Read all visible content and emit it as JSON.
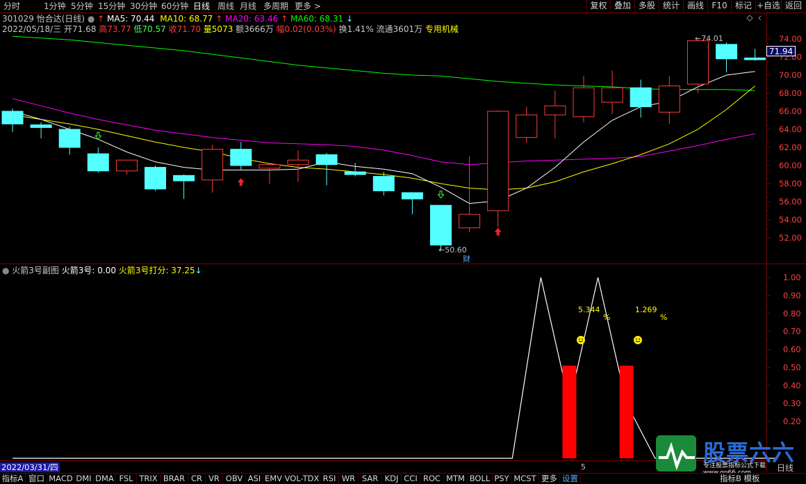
{
  "topbar": {
    "periods": [
      "分时",
      "1分钟",
      "5分钟",
      "15分钟",
      "30分钟",
      "60分钟",
      "日线",
      "周线",
      "月线",
      "多周期",
      "更多 >"
    ],
    "active_period": "日线",
    "right_buttons": [
      "复权",
      "叠加",
      "多股",
      "统计",
      "画线",
      "F10",
      "标记",
      "+自选",
      "返回"
    ]
  },
  "stock_info": {
    "code_name": "301029 怡合达(日线)",
    "ma5": "MA5: 70.44",
    "ma10": "MA10: 68.77",
    "ma20": "MA20: 63.46",
    "ma60": "MA60: 68.31",
    "date": "2022/05/18/三",
    "open": "开71.68",
    "high": "高73.77",
    "low": "低70.57",
    "close": "收71.70",
    "volume": "量5073",
    "amount": "额3666万",
    "change": "幅0.02(0.03%)",
    "turnover": "换1.41%",
    "float": "流通3601万",
    "industry": "专用机械"
  },
  "price_axis": {
    "labels": [
      "74.00",
      "72.00",
      "70.00",
      "68.00",
      "66.00",
      "64.00",
      "62.00",
      "60.00",
      "58.00",
      "56.00",
      "54.00",
      "52.00"
    ],
    "current_price": "71.94",
    "max_label": "74.01",
    "min_label": "50.60",
    "finance_tag": "财"
  },
  "indicator": {
    "title": "火箭3号副图",
    "value1": "火箭3号: 0.00",
    "value2": "火箭3号打分: 37.25",
    "axis_labels": [
      "1.00",
      "0.90",
      "0.80",
      "0.70",
      "0.60",
      "0.50",
      "0.40",
      "0.30",
      "0.20"
    ],
    "pct1": "5.344",
    "pct2": "1.269",
    "pct_sign": "%",
    "date_box": "2022/03/31/四",
    "tick": "5",
    "period_corner": "日线"
  },
  "chart_data": {
    "type": "candlestick",
    "ylim": [
      50.5,
      75.5
    ],
    "candles": [
      {
        "o": 66.0,
        "h": 66.3,
        "c": 64.6,
        "l": 63.7
      },
      {
        "o": 64.5,
        "h": 64.8,
        "c": 64.2,
        "l": 63.0
      },
      {
        "o": 64.0,
        "h": 64.3,
        "c": 62.0,
        "l": 61.2
      },
      {
        "o": 61.3,
        "h": 62.0,
        "c": 59.4,
        "l": 59.2
      },
      {
        "o": 59.4,
        "h": 60.5,
        "c": 60.6,
        "l": 59.0
      },
      {
        "o": 59.8,
        "h": 60.0,
        "c": 57.4,
        "l": 57.2
      },
      {
        "o": 58.9,
        "h": 59.0,
        "c": 58.3,
        "l": 56.3
      },
      {
        "o": 58.4,
        "h": 62.3,
        "c": 61.8,
        "l": 57.0
      },
      {
        "o": 61.8,
        "h": 62.6,
        "c": 60.0,
        "l": 59.5
      },
      {
        "o": 59.7,
        "h": 60.3,
        "c": 60.1,
        "l": 58.0
      },
      {
        "o": 60.1,
        "h": 61.7,
        "c": 60.6,
        "l": 58.2
      },
      {
        "o": 61.2,
        "h": 61.4,
        "c": 60.1,
        "l": 57.8
      },
      {
        "o": 59.3,
        "h": 60.3,
        "c": 59.0,
        "l": 58.8
      },
      {
        "o": 58.8,
        "h": 59.3,
        "c": 57.2,
        "l": 56.7
      },
      {
        "o": 57.0,
        "h": 57.0,
        "c": 56.3,
        "l": 54.6
      },
      {
        "o": 55.6,
        "h": 55.6,
        "c": 51.2,
        "l": 50.6
      },
      {
        "o": 53.1,
        "h": 61.0,
        "c": 54.6,
        "l": 52.6
      },
      {
        "o": 55.0,
        "h": 66.1,
        "c": 66.0,
        "l": 53.2
      },
      {
        "o": 63.1,
        "h": 66.5,
        "c": 65.6,
        "l": 62.5
      },
      {
        "o": 65.6,
        "h": 68.3,
        "c": 66.6,
        "l": 63.0
      },
      {
        "o": 65.4,
        "h": 69.9,
        "c": 68.6,
        "l": 64.8
      },
      {
        "o": 67.0,
        "h": 70.5,
        "c": 68.6,
        "l": 65.7
      },
      {
        "o": 68.6,
        "h": 69.5,
        "c": 66.5,
        "l": 65.3
      },
      {
        "o": 65.9,
        "h": 69.9,
        "c": 68.8,
        "l": 64.6
      },
      {
        "o": 69.0,
        "h": 74.0,
        "c": 73.8,
        "l": 68.0
      },
      {
        "o": 73.4,
        "h": 73.6,
        "c": 71.8,
        "l": 70.3
      },
      {
        "o": 71.9,
        "h": 72.9,
        "c": 71.7,
        "l": 71.6
      }
    ],
    "ma5": [
      66.0,
      65.1,
      64.0,
      62.9,
      61.5,
      60.4,
      59.8,
      59.5,
      59.5,
      59.5,
      59.6,
      60.4,
      59.9,
      59.6,
      59.1,
      57.6,
      55.8,
      56.1,
      57.5,
      59.8,
      62.6,
      65.0,
      66.5,
      67.1,
      68.7,
      70.0,
      70.4
    ],
    "ma10": [
      65.6,
      65.1,
      64.6,
      64.0,
      63.3,
      62.6,
      62.0,
      61.5,
      60.8,
      60.2,
      59.8,
      59.6,
      59.3,
      59.0,
      58.6,
      58.0,
      57.5,
      57.3,
      57.5,
      58.2,
      59.3,
      60.2,
      61.2,
      62.4,
      64.0,
      66.2,
      68.8
    ],
    "ma20": [
      67.4,
      66.6,
      65.8,
      65.1,
      64.5,
      63.9,
      63.5,
      63.1,
      62.8,
      62.5,
      62.4,
      62.3,
      62.1,
      61.7,
      61.1,
      60.4,
      60.1,
      60.3,
      60.5,
      60.6,
      60.7,
      60.8,
      61.0,
      61.6,
      62.2,
      62.9,
      63.5
    ],
    "ma60": [
      74.3,
      74.1,
      73.9,
      73.6,
      73.3,
      73.0,
      72.7,
      72.3,
      71.9,
      71.5,
      71.1,
      70.8,
      70.5,
      70.2,
      70.0,
      69.9,
      69.6,
      69.3,
      69.1,
      68.9,
      68.8,
      68.7,
      68.5,
      68.4,
      68.4,
      68.4,
      68.3
    ],
    "indicator_line": [
      [
        0,
        0
      ],
      [
        17.5,
        0
      ],
      [
        18.5,
        1.0
      ],
      [
        19.5,
        0.3
      ],
      [
        20.5,
        1.0
      ],
      [
        21.5,
        0.3
      ],
      [
        22.5,
        0
      ],
      [
        26.8,
        0
      ]
    ],
    "indicator_bars": [
      {
        "i": 19.5,
        "v": 0.51
      },
      {
        "i": 21.5,
        "v": 0.51
      }
    ]
  },
  "colors": {
    "up": "#ff3c3c",
    "down": "#54ffff",
    "ma5": "#ffffff",
    "ma10": "#ffff00",
    "ma20": "#ff00ff",
    "ma60": "#00ff00",
    "grid": "#7a0000"
  },
  "bottombar": {
    "tabs": [
      "指标A",
      "窗口",
      "MACD",
      "DMI",
      "DMA",
      "FSL",
      "TRIX",
      "BRAR",
      "CR",
      "VR",
      "OBV",
      "ASI",
      "EMV",
      "VOL-TDX",
      "RSI",
      "WR",
      "SAR",
      "KDJ",
      "CCI",
      "ROC",
      "MTM",
      "BOLL",
      "PSY",
      "MCST",
      "更多",
      "设置"
    ],
    "right_tools": [
      "指标B",
      "模板"
    ]
  },
  "logo": {
    "title": "股票六六",
    "subtitle": "专注股票指标公式下载 www.gp66.com"
  }
}
